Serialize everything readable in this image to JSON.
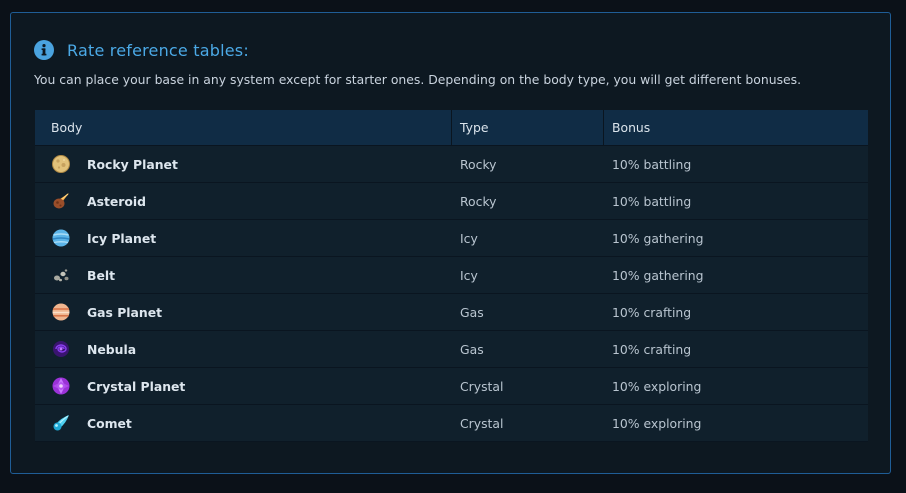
{
  "header": {
    "title": "Rate reference tables:",
    "description": "You can place your base in any system except for starter ones. Depending on the body type, you will get different bonuses."
  },
  "table": {
    "columns": [
      "Body",
      "Type",
      "Bonus"
    ],
    "rows": [
      {
        "icon": "rocky-planet-icon",
        "body": "Rocky Planet",
        "type": "Rocky",
        "bonus": "10% battling"
      },
      {
        "icon": "asteroid-icon",
        "body": "Asteroid",
        "type": "Rocky",
        "bonus": "10% battling"
      },
      {
        "icon": "icy-planet-icon",
        "body": "Icy Planet",
        "type": "Icy",
        "bonus": "10% gathering"
      },
      {
        "icon": "belt-icon",
        "body": "Belt",
        "type": "Icy",
        "bonus": "10% gathering"
      },
      {
        "icon": "gas-planet-icon",
        "body": "Gas Planet",
        "type": "Gas",
        "bonus": "10% crafting"
      },
      {
        "icon": "nebula-icon",
        "body": "Nebula",
        "type": "Gas",
        "bonus": "10% crafting"
      },
      {
        "icon": "crystal-planet-icon",
        "body": "Crystal Planet",
        "type": "Crystal",
        "bonus": "10% exploring"
      },
      {
        "icon": "comet-icon",
        "body": "Comet",
        "type": "Crystal",
        "bonus": "10% exploring"
      }
    ]
  },
  "colors": {
    "accent": "#4ba9e6",
    "border": "#1f5d96",
    "header_bg": "#102c45",
    "row_bg": "#10202c"
  }
}
